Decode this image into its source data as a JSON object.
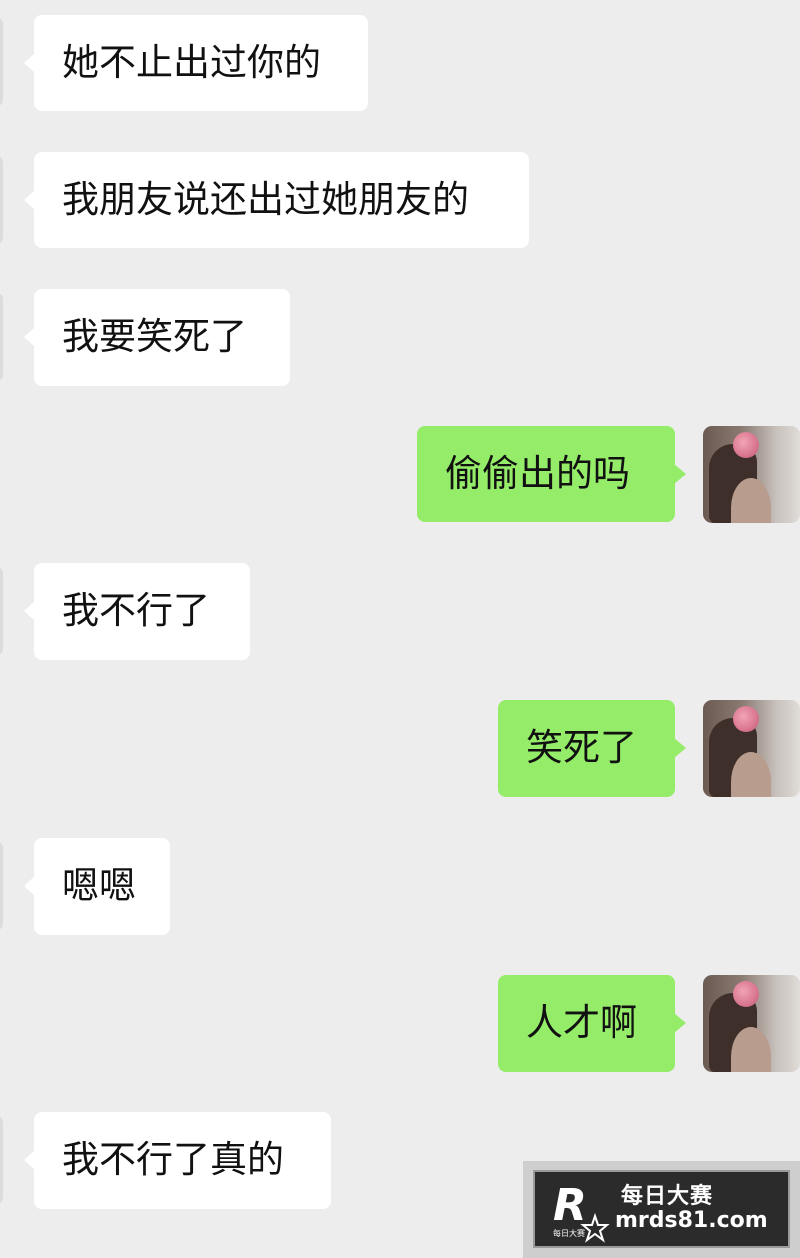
{
  "messages": [
    {
      "side": "in",
      "text": "她不止出过你的"
    },
    {
      "side": "in",
      "text": "我朋友说还出过她朋友的"
    },
    {
      "side": "in",
      "text": "我要笑死了"
    },
    {
      "side": "out",
      "text": "偷偷出的吗"
    },
    {
      "side": "in",
      "text": "我不行了"
    },
    {
      "side": "out",
      "text": "笑死了"
    },
    {
      "side": "in",
      "text": "嗯嗯"
    },
    {
      "side": "out",
      "text": "人才啊"
    },
    {
      "side": "in",
      "text": "我不行了真的"
    }
  ],
  "watermark": {
    "logo_text": "R",
    "logo_subtext": "每日大赛",
    "title": "每日大赛",
    "url": "mrds81.com"
  },
  "colors": {
    "background": "#ededed",
    "incoming_bubble": "#ffffff",
    "outgoing_bubble": "#95ec69",
    "text": "#111111"
  }
}
